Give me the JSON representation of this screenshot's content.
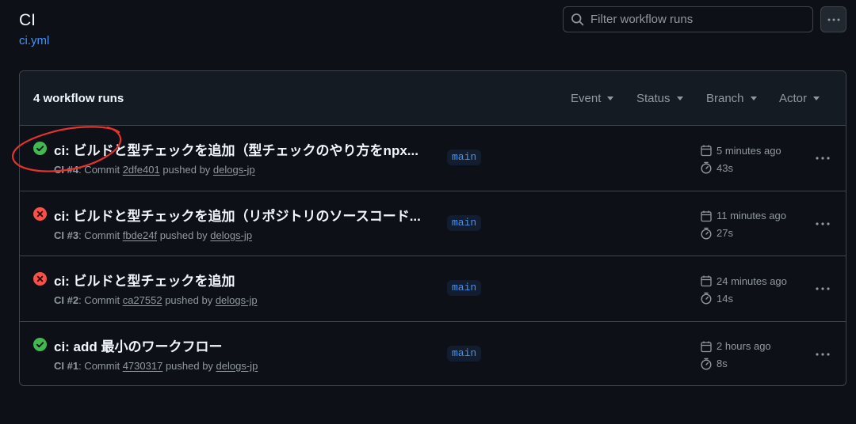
{
  "page": {
    "title": "CI",
    "file_link": "ci.yml"
  },
  "search": {
    "placeholder": "Filter workflow runs",
    "icon": "search-icon"
  },
  "runs_header": {
    "count_label": "4 workflow runs",
    "filters": [
      {
        "label": "Event"
      },
      {
        "label": "Status"
      },
      {
        "label": "Branch"
      },
      {
        "label": "Actor"
      }
    ]
  },
  "runs": [
    {
      "status": "success",
      "title": "ci: ビルドと型チェックを追加（型チェックのやり方をnpx...",
      "workflow": "CI #4",
      "commit_prefix": ": Commit ",
      "commit": "2dfe401",
      "pushed_by": " pushed by ",
      "actor": "delogs-jp",
      "branch": "main",
      "time_ago": "5 minutes ago",
      "duration": "43s"
    },
    {
      "status": "failure",
      "title": "ci: ビルドと型チェックを追加（リポジトリのソースコード...",
      "workflow": "CI #3",
      "commit_prefix": ": Commit ",
      "commit": "fbde24f",
      "pushed_by": " pushed by ",
      "actor": "delogs-jp",
      "branch": "main",
      "time_ago": "11 minutes ago",
      "duration": "27s"
    },
    {
      "status": "failure",
      "title": "ci: ビルドと型チェックを追加",
      "workflow": "CI #2",
      "commit_prefix": ": Commit ",
      "commit": "ca27552",
      "pushed_by": " pushed by ",
      "actor": "delogs-jp",
      "branch": "main",
      "time_ago": "24 minutes ago",
      "duration": "14s"
    },
    {
      "status": "success",
      "title": "ci: add 最小のワークフロー",
      "workflow": "CI #1",
      "commit_prefix": ": Commit ",
      "commit": "4730317",
      "pushed_by": " pushed by ",
      "actor": "delogs-jp",
      "branch": "main",
      "time_ago": "2 hours ago",
      "duration": "8s"
    }
  ],
  "colors": {
    "background": "#0d1117",
    "success": "#3fb950",
    "failure": "#f85149",
    "link": "#4493f8",
    "annotation": "#e5322d"
  }
}
